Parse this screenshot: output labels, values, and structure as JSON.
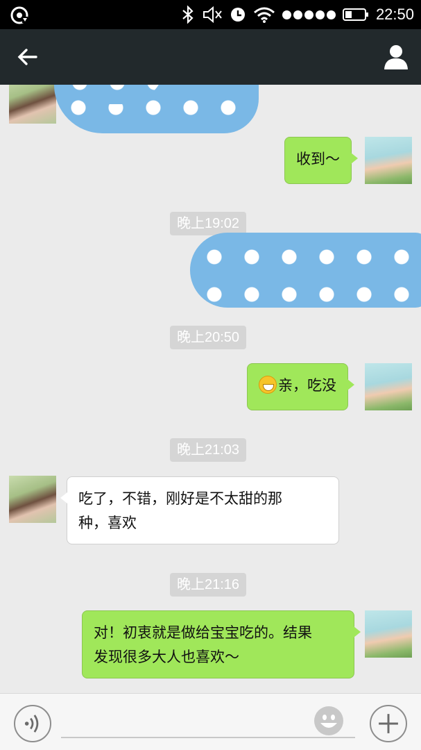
{
  "status_bar": {
    "time": "22:50",
    "icons": [
      "sync-icon",
      "bluetooth-icon",
      "mute-icon",
      "alarm-icon",
      "wifi-icon",
      "signal-icon",
      "battery-icon"
    ]
  },
  "title_bar": {
    "back_icon": "arrow-left-icon",
    "profile_icon": "person-icon"
  },
  "messages": [
    {
      "side": "left",
      "type": "redacted",
      "avatar": "girl"
    },
    {
      "side": "right",
      "type": "text",
      "text": "收到～",
      "avatar": "baby"
    },
    {
      "type": "timestamp",
      "text": "晚上19:02"
    },
    {
      "side": "right",
      "type": "redacted",
      "avatar": "none"
    },
    {
      "type": "timestamp",
      "text": "晚上20:50"
    },
    {
      "side": "right",
      "type": "text",
      "text": "亲，吃没",
      "emoji": "grin-emoji",
      "avatar": "baby"
    },
    {
      "type": "timestamp",
      "text": "晚上21:03"
    },
    {
      "side": "left",
      "type": "text",
      "text_line1": "吃了，不错，刚好是不太甜的那",
      "text_line2": "种，喜欢",
      "avatar": "girl"
    },
    {
      "type": "timestamp",
      "text": "晚上21:16"
    },
    {
      "side": "right",
      "type": "text",
      "text_line1": "对！初衷就是做给宝宝吃的。结果",
      "text_line2": "发现很多大人也喜欢～",
      "avatar": "baby"
    }
  ],
  "input_bar": {
    "voice_icon": "voice-icon",
    "emoji_icon": "smiley-icon",
    "plus_icon": "plus-icon",
    "text_value": ""
  }
}
